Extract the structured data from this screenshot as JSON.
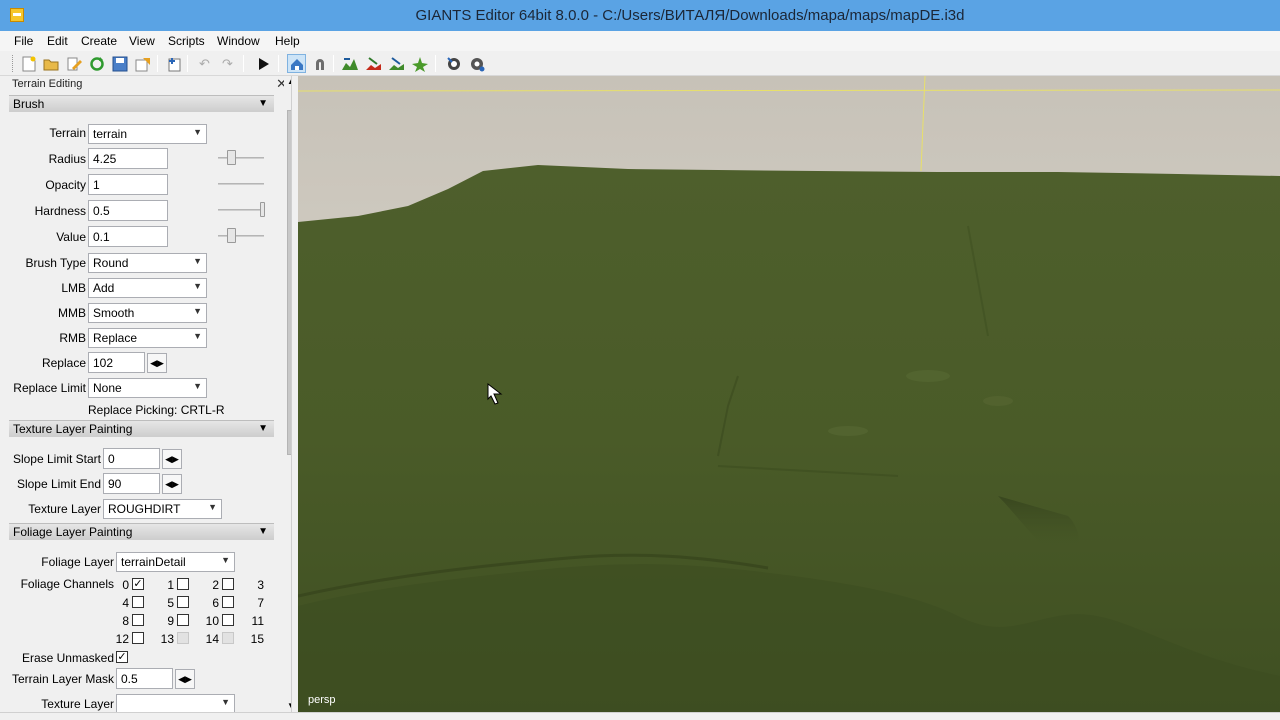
{
  "window": {
    "title": "GIANTS Editor 64bit 8.0.0 - C:/Users/ВИТАЛЯ/Downloads/mapa/maps/mapDE.i3d"
  },
  "menu": [
    "File",
    "Edit",
    "Create",
    "View",
    "Scripts",
    "Window",
    "Help"
  ],
  "panel": {
    "title": "Terrain Editing",
    "close": "✕",
    "brush": {
      "header": "Brush",
      "terrain_label": "Terrain",
      "terrain_value": "terrain",
      "radius_label": "Radius",
      "radius_value": "4.25",
      "opacity_label": "Opacity",
      "opacity_value": "1",
      "hardness_label": "Hardness",
      "hardness_value": "0.5",
      "value_label": "Value",
      "value_value": "0.1",
      "brushtype_label": "Brush Type",
      "brushtype_value": "Round",
      "lmb_label": "LMB",
      "lmb_value": "Add",
      "mmb_label": "MMB",
      "mmb_value": "Smooth",
      "rmb_label": "RMB",
      "rmb_value": "Replace",
      "replace_label": "Replace",
      "replace_value": "102",
      "replacelimit_label": "Replace Limit",
      "replacelimit_value": "None",
      "picking_hint": "Replace Picking: CRTL-R"
    },
    "texture": {
      "header": "Texture Layer Painting",
      "slopestart_label": "Slope Limit Start",
      "slopestart_value": "0",
      "slopeend_label": "Slope Limit End",
      "slopeend_value": "90",
      "layer_label": "Texture Layer",
      "layer_value": "ROUGHDIRT"
    },
    "foliage": {
      "header": "Foliage Layer Painting",
      "layer_label": "Foliage Layer",
      "layer_value": "terrainDetail",
      "channels_label": "Foliage Channels",
      "channels": [
        "0",
        "1",
        "2",
        "3",
        "4",
        "5",
        "6",
        "7",
        "8",
        "9",
        "10",
        "11",
        "12",
        "13",
        "14",
        "15"
      ],
      "erase_label": "Erase Unmasked",
      "mask_label": "Terrain Layer Mask",
      "mask_value": "0.5",
      "texlayer_label": "Texture Layer",
      "texlayer_value": ""
    }
  },
  "viewport": {
    "camera_label": "persp"
  },
  "colors": {
    "titlebar": "#5aa3e4",
    "terrain": "#4d5f2a",
    "sky": "#d9d6cf"
  }
}
